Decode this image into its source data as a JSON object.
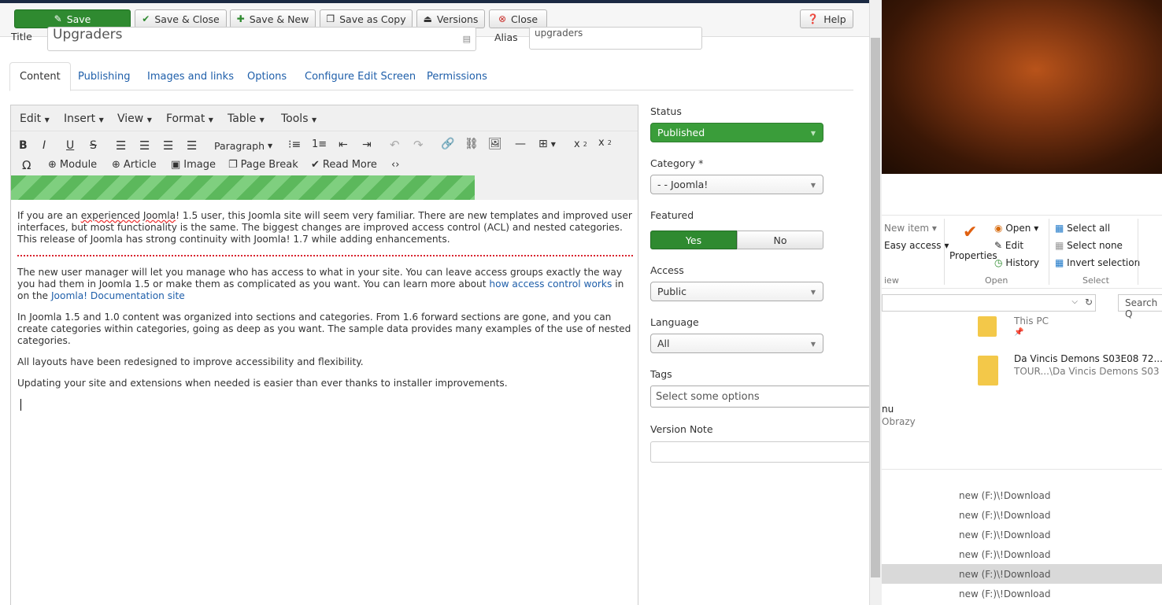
{
  "toolbar": {
    "save": "Save",
    "save_close": "Save & Close",
    "save_new": "Save & New",
    "save_copy": "Save as Copy",
    "versions": "Versions",
    "close": "Close",
    "help": "Help"
  },
  "form": {
    "title_label": "Title",
    "title_value": "Upgraders",
    "alias_label": "Alias",
    "alias_value": "upgraders"
  },
  "tabs": [
    "Content",
    "Publishing",
    "Images and links",
    "Options",
    "Configure Edit Screen",
    "Permissions"
  ],
  "editor": {
    "menu": [
      "Edit",
      "Insert",
      "View",
      "Format",
      "Table",
      "Tools"
    ],
    "format_select": "Paragraph",
    "buttons": {
      "module": "Module",
      "article": "Article",
      "image": "Image",
      "page_break": "Page Break",
      "read_more": "Read More"
    },
    "progress": 0.74,
    "content": {
      "p1a": "If you are an ",
      "p1b": "experienced",
      "p1c": " ",
      "p1d": "Joomla",
      "p1e": "! 1.5 user, this Joomla site will seem very familiar. There are new templates and improved user interfaces, but most functionality is the same. The biggest changes are improved access control (ACL) and nested categories. This release of Joomla has strong continuity with Joomla! 1.7 while adding enhancements.",
      "p2a": "The new user manager will let you manage who has access to what in your site. You can leave access groups exactly the way you had them in Joomla 1.5 or make them as complicated as you want. You can learn more about ",
      "p2link1": "how access control works",
      "p2b": " in on the ",
      "p2link2": "Joomla! Documentation site",
      "p3": "In Joomla 1.5 and 1.0 content was organized into sections and categories. From 1.6 forward sections are gone, and you can create categories within categories, going as deep as you want. The sample data provides many examples of the use of nested categories.",
      "p4": "All layouts have been redesigned to improve accessibility and flexibility.",
      "p5": "Updating your site and extensions when needed is easier than ever thanks to installer improvements."
    }
  },
  "sidebar": {
    "status_label": "Status",
    "status_value": "Published",
    "category_label": "Category",
    "category_required": "*",
    "category_value": "- - Joomla!",
    "featured_label": "Featured",
    "featured_yes": "Yes",
    "featured_no": "No",
    "access_label": "Access",
    "access_value": "Public",
    "language_label": "Language",
    "language_value": "All",
    "tags_label": "Tags",
    "tags_placeholder": "Select some options",
    "version_note_label": "Version Note"
  },
  "explorer": {
    "new_item": "New item",
    "easy_access": "Easy access",
    "view_group": "iew",
    "properties": "Properties",
    "open": "Open",
    "edit": "Edit",
    "history": "History",
    "open_group": "Open",
    "select_all": "Select all",
    "select_none": "Select none",
    "invert_selection": "Invert selection",
    "select_group": "Select",
    "search": "Search Q",
    "this_pc": "This PC",
    "folder_name": "Da Vincis Demons S03E08 72...",
    "folder_path": "TOUR...\\Da Vincis Demons S03",
    "nu": "nu",
    "obrazy": "Obrazy",
    "downloads": [
      "new (F:)\\!Download",
      "new (F:)\\!Download",
      "new (F:)\\!Download",
      "new (F:)\\!Download",
      "new (F:)\\!Download",
      "new (F:)\\!Download"
    ]
  },
  "colors": {
    "save": "#2f8a30",
    "published": "#3a9d3a",
    "yes": "#2f8a30",
    "link": "#1f5faa",
    "topbar_border": "#1b2a43"
  }
}
